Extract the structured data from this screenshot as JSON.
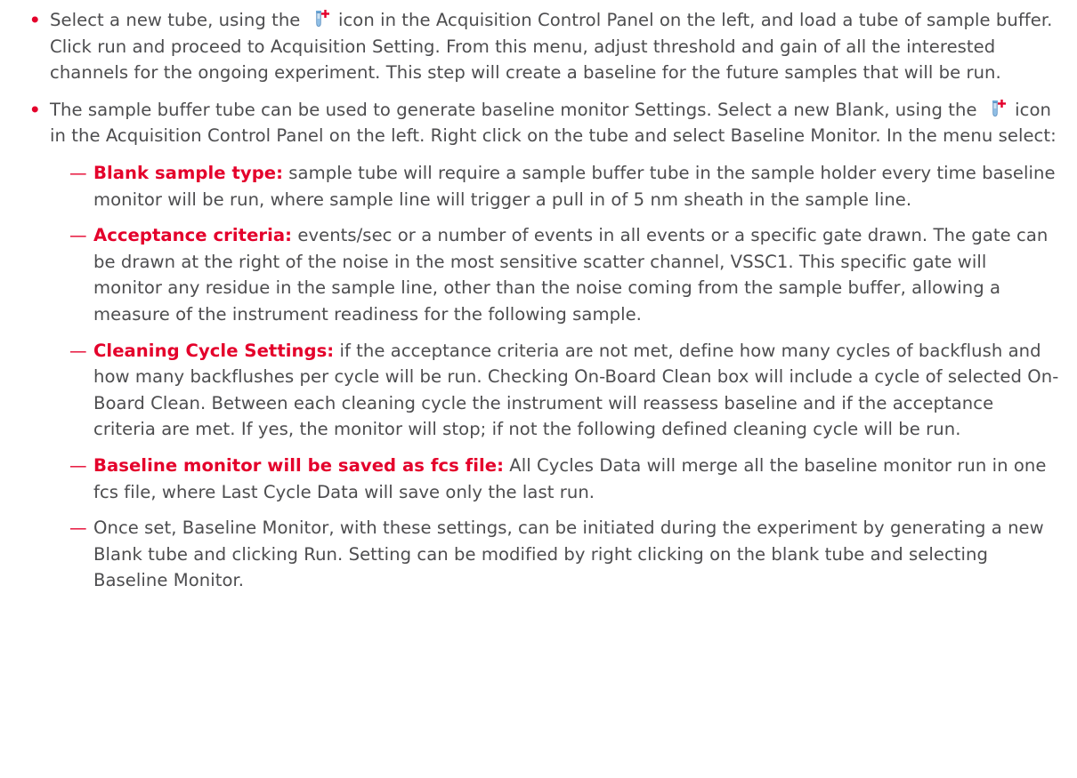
{
  "bullets": [
    {
      "text_before_icon": "Select a new tube, using the",
      "icon": "add-tube-icon",
      "text_after_icon": " icon in the Acquisition Control Panel on the left, and load a tube of sample buffer. Click run and proceed to Acquisition Setting. From this menu, adjust threshold and gain of all the interested channels for the ongoing experiment. This step will create a baseline for the future samples that will be run."
    },
    {
      "text_before_icon": "The sample buffer tube can be used to generate baseline monitor Settings. Select a new Blank, using the",
      "icon": "add-tube-icon",
      "text_after_icon": " icon in the Acquisition Control Panel on the left. Right click on the tube and select Baseline Monitor. In the menu select:",
      "sub_items": [
        {
          "term": "Blank sample type:",
          "text": " sample tube will require a sample buffer tube in the sample holder every time baseline monitor will be run, where sample line will trigger a pull in of 5 nm sheath in the sample line."
        },
        {
          "term": "Acceptance criteria:",
          "text": " events/sec or a number of events in all events or a specific gate drawn. The gate can be drawn at the right of the noise in the most sensitive scatter channel, VSSC1. This specific gate will monitor any residue in the sample line, other than the noise coming from the sample buffer, allowing a measure of the instrument readiness for the following sample."
        },
        {
          "term": "Cleaning Cycle Settings:",
          "text": " if the acceptance criteria are not met, define how many cycles of backflush and how many backflushes per cycle will be run. Checking On-Board Clean box will include a cycle of selected On-Board Clean. Between each cleaning cycle the instrument will reassess baseline and if the acceptance criteria are met. If yes, the monitor will stop; if not the following defined cleaning cycle will be run."
        },
        {
          "term": "Baseline monitor will be saved as fcs file:",
          "text": " All Cycles Data will merge all the baseline monitor run in one fcs file, where Last Cycle Data will save only the last run."
        },
        {
          "term": "",
          "text": "Once set, Baseline Monitor, with these settings, can be initiated during the experiment by generating a new Blank tube and clicking Run. Setting can be modified by right clicking on the blank tube and selecting Baseline Monitor."
        }
      ]
    }
  ],
  "colors": {
    "accent": "#e4002b",
    "body_text": "#4d4d4f"
  },
  "glyphs": {
    "bullet": "•",
    "dash": "—"
  }
}
